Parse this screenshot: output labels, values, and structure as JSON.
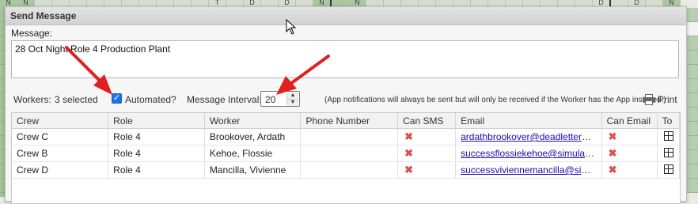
{
  "dialog": {
    "title": "Send Message"
  },
  "message": {
    "label": "Message:",
    "text": "28 Oct Night Role 4 Production Plant"
  },
  "options": {
    "workers_label": "Workers:",
    "workers_count": "3 selected",
    "automated_label": "Automated?",
    "automated_checked": true,
    "interval_label": "Message Interval:",
    "interval_value": "20",
    "note": "(App notifications will always be sent but will only be received if the Worker has the App installed.)",
    "print_label": "Print"
  },
  "table": {
    "columns": [
      "Crew",
      "Role",
      "Worker",
      "Phone Number",
      "Can SMS",
      "Email",
      "Can Email",
      "To"
    ],
    "rows": [
      {
        "crew": "Crew C",
        "role": "Role 4",
        "worker": "Brookover, Ardath",
        "phone": "",
        "email": "ardathbrookover@deadletterbin.rk"
      },
      {
        "crew": "Crew B",
        "role": "Role 4",
        "worker": "Kehoe, Flossie",
        "phone": "",
        "email": "successflossiekehoe@simulator.a..."
      },
      {
        "crew": "Crew D",
        "role": "Role 4",
        "worker": "Mancilla, Vivienne",
        "phone": "",
        "email": "successviviennemancilla@simulat..."
      }
    ]
  },
  "background_grid": {
    "header_letters": [
      "N",
      "N",
      "",
      "",
      "",
      "",
      "",
      "",
      "",
      "",
      "",
      "",
      "T",
      "",
      "D",
      "",
      "D",
      "",
      "N",
      "",
      "N",
      "",
      "",
      "",
      "",
      "",
      "",
      "",
      "",
      "",
      "",
      "",
      "",
      "",
      "D",
      "",
      "D",
      "",
      "N"
    ]
  },
  "colors": {
    "accent": "#1a73e8",
    "annotation": "#e02020",
    "no_icon": "#d9534f"
  }
}
